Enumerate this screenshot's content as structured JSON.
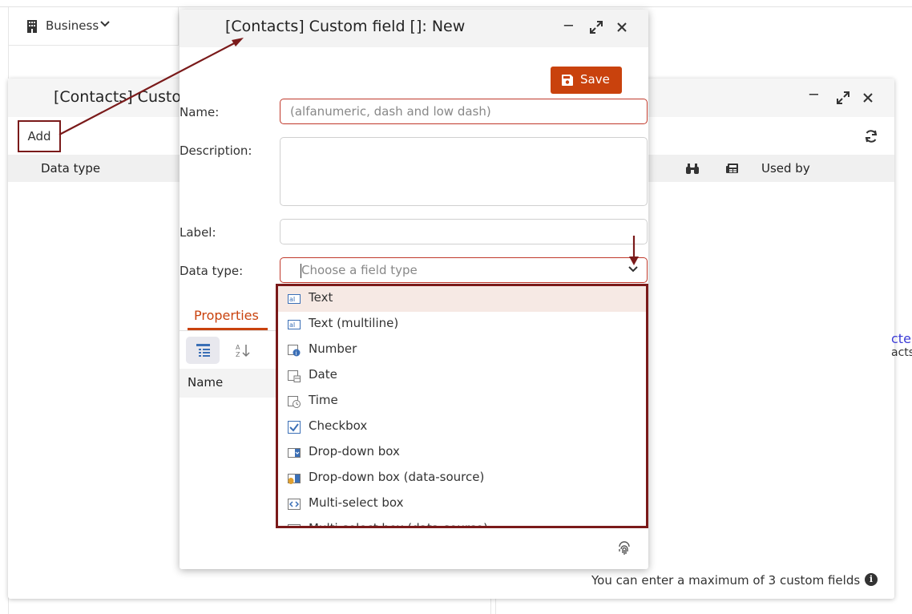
{
  "topbar": {
    "business_label": "Business"
  },
  "back_dialog": {
    "title": "[Contacts] Custom fields",
    "add_label": "Add",
    "col_data_type": "Data type",
    "col_used_by": "Used by",
    "footnote": "You can enter a maximum of 3 custom fields",
    "peek_link": "cte",
    "peek_text": "acts"
  },
  "dialog": {
    "title": "[Contacts] Custom field []: New",
    "save_label": "Save",
    "name_label": "Name:",
    "name_placeholder": "(alfanumeric, dash and low dash)",
    "description_label": "Description:",
    "label_label": "Label:",
    "data_type_label": "Data type:",
    "data_type_placeholder": "Choose a field type",
    "properties_tab": "Properties",
    "grid_name_header": "Name"
  },
  "data_type_options": [
    {
      "label": "Text",
      "icon": "text-type-icon",
      "selected": true
    },
    {
      "label": "Text (multiline)",
      "icon": "text-multiline-icon"
    },
    {
      "label": "Number",
      "icon": "number-icon"
    },
    {
      "label": "Date",
      "icon": "date-icon"
    },
    {
      "label": "Time",
      "icon": "time-icon"
    },
    {
      "label": "Checkbox",
      "icon": "checkbox-icon"
    },
    {
      "label": "Drop-down box",
      "icon": "dropdown-icon"
    },
    {
      "label": "Drop-down box (data-source)",
      "icon": "dropdown-datasource-icon"
    },
    {
      "label": "Multi-select box",
      "icon": "multiselect-icon"
    },
    {
      "label": "Multi-select box (data-source)",
      "icon": "multiselect-datasource-icon"
    }
  ],
  "colors": {
    "accent": "#c9420d",
    "highlight_border": "#7a1a1a",
    "selected_bg": "#f6e9e4"
  }
}
